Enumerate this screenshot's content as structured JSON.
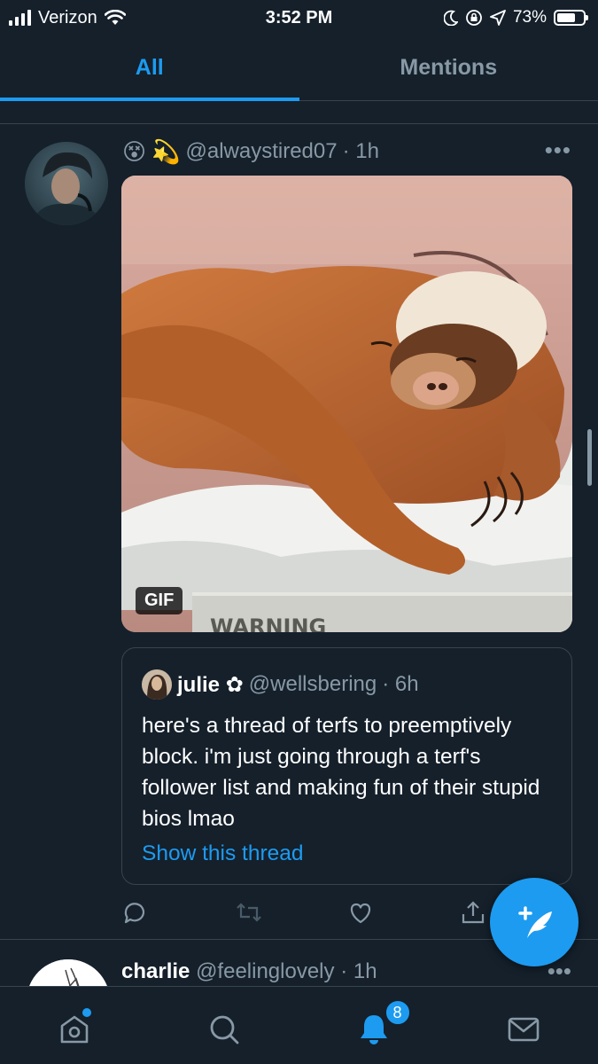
{
  "status_bar": {
    "carrier": "Verizon",
    "time": "3:52 PM",
    "battery": "73%",
    "battery_level": 0.73,
    "icons": [
      "signal-icon",
      "wifi-icon",
      "moon-icon",
      "lock-rotation-icon",
      "location-icon",
      "battery-icon"
    ]
  },
  "tabs": [
    {
      "label": "All",
      "active": true
    },
    {
      "label": "Mentions",
      "active": false
    }
  ],
  "tweet": {
    "emojis": [
      "😵",
      "💫"
    ],
    "handle": "@alwaystired07",
    "time": "· 1h",
    "more": "•••",
    "media": {
      "badge": "GIF",
      "caption": "WARNING"
    },
    "quote": {
      "name": "julie ✿",
      "handle": "@wellsbering",
      "time": "· 6h",
      "text": "here's a thread of terfs to preemptively block. i'm just going through a terf's follower list and making fun of their stupid bios lmao",
      "show_thread": "Show this thread"
    },
    "actions": [
      "reply-icon",
      "retweet-icon",
      "like-icon",
      "share-icon"
    ]
  },
  "next_tweet": {
    "name": "charlie",
    "handle": "@feelinglovely",
    "time": "· 1h",
    "more": "•••"
  },
  "fab": {
    "icon": "compose-tweet-icon"
  },
  "bottom_nav": {
    "items": [
      "home-icon",
      "search-icon",
      "notifications-icon",
      "messages-icon"
    ],
    "notification_count": "8"
  },
  "colors": {
    "background": "#15202b",
    "accent": "#1d9bf0",
    "secondary_text": "#8899a6",
    "divider": "#38444d"
  }
}
